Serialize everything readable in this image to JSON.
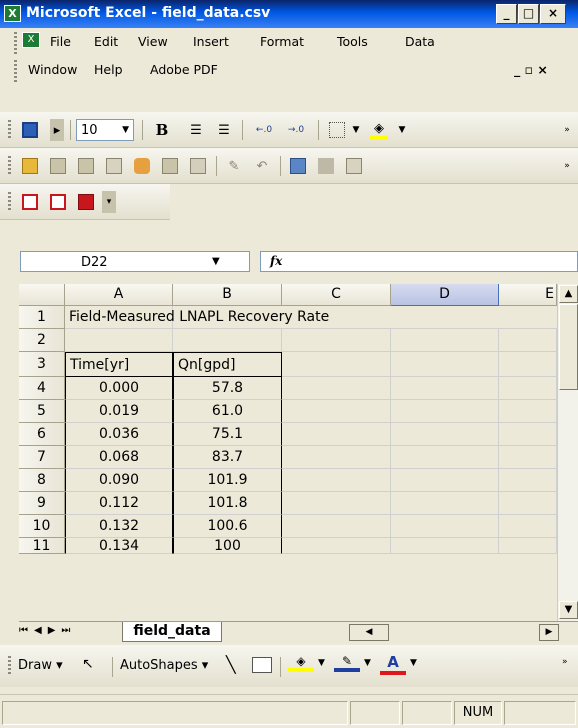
{
  "window": {
    "title": "Microsoft Excel - field_data.csv",
    "min": "_",
    "max": "□",
    "close": "×"
  },
  "menu": {
    "items": [
      "File",
      "Edit",
      "View",
      "Insert",
      "Format",
      "Tools",
      "Data",
      "Window",
      "Help",
      "Adobe PDF"
    ],
    "doc_restore": "_ ▫ ×"
  },
  "formatting": {
    "font_size": "10",
    "bold": "B",
    "dec_inc": ".00→.0",
    "dec_dec": ".0→.00"
  },
  "namebox": {
    "value": "D22"
  },
  "formula": {
    "fx": "fx",
    "value": ""
  },
  "sheet": {
    "columns": [
      "A",
      "B",
      "C",
      "D",
      "E"
    ],
    "rows": [
      "1",
      "2",
      "3",
      "4",
      "5",
      "6",
      "7",
      "8",
      "9",
      "10",
      "11"
    ],
    "title": "Field-Measured LNAPL Recovery Rate",
    "header": [
      "Time[yr]",
      "Qn[gpd]"
    ],
    "data": [
      [
        "0.000",
        "57.8"
      ],
      [
        "0.019",
        "61.0"
      ],
      [
        "0.036",
        "75.1"
      ],
      [
        "0.068",
        "83.7"
      ],
      [
        "0.090",
        "101.9"
      ],
      [
        "0.112",
        "101.8"
      ],
      [
        "0.132",
        "100.6"
      ],
      [
        "0.134",
        "100"
      ]
    ]
  },
  "tab": {
    "name": "field_data"
  },
  "drawing": {
    "draw": "Draw",
    "autoshapes": "AutoShapes"
  },
  "status": {
    "num": "NUM"
  },
  "colors": {
    "title_bar": "#0058e6",
    "grid": "#d0d0d0",
    "selected_col": "#c0c9e7"
  }
}
